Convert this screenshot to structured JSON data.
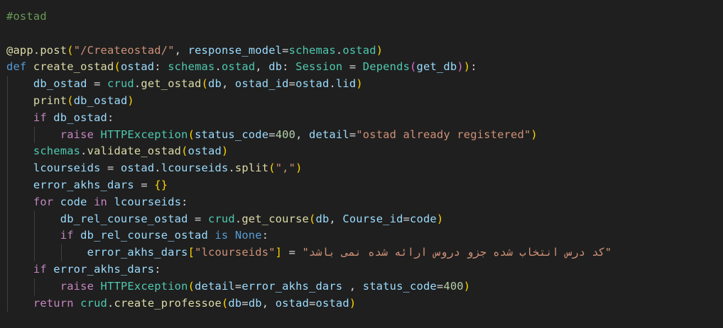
{
  "editor": {
    "comment": "#ostad",
    "decorator": {
      "at": "@",
      "obj": "app",
      "method": "post",
      "route": "\"/Createostad/\"",
      "param": "response_model",
      "schemas": "schemas",
      "model": "ostad"
    },
    "def_line": {
      "kw": "def",
      "name": "create_ostad",
      "p1": "ostad",
      "t1mod": "schemas",
      "t1cls": "ostad",
      "p2": "db",
      "t2": "Session",
      "fn": "Depends",
      "arg": "get_db"
    },
    "l3": {
      "var": "db_ostad",
      "mod": "crud",
      "fn": "get_ostad",
      "a1": "db",
      "kw": "ostad_id",
      "obj": "ostad",
      "attr": "lid"
    },
    "l4": {
      "fn": "print",
      "arg": "db_ostad"
    },
    "l5": {
      "kw": "if",
      "var": "db_ostad"
    },
    "l6": {
      "kw": "raise",
      "cls": "HTTPException",
      "k1": "status_code",
      "n1": "400",
      "k2": "detail",
      "s": "\"ostad already registered\""
    },
    "l7": {
      "mod": "schemas",
      "fn": "validate_ostad",
      "arg": "ostad"
    },
    "l8": {
      "var": "lcourseids",
      "obj": "ostad",
      "attr": "lcourseids",
      "fn": "split",
      "s": "\",\""
    },
    "l9": {
      "var": "error_akhs_dars",
      "val": "{}"
    },
    "l10": {
      "kw1": "for",
      "v": "code",
      "kw2": "in",
      "it": "lcourseids"
    },
    "l11": {
      "var": "db_rel_course_ostad",
      "mod": "crud",
      "fn": "get_course",
      "a1": "db",
      "kw": "Course_id",
      "a2": "code"
    },
    "l12": {
      "kw": "if",
      "var": "db_rel_course_ostad",
      "is": "is",
      "none": "None"
    },
    "l13": {
      "var": "error_akhs_dars",
      "key": "\"lcourseids\"",
      "persian": "\"کد درس انتخاب شده جزو دروس ارائه شده نمی باشد\""
    },
    "l14": {
      "kw": "if",
      "var": "error_akhs_dars"
    },
    "l15": {
      "kw": "raise",
      "cls": "HTTPException",
      "k1": "detail",
      "v1": "error_akhs_dars",
      "k2": "status_code",
      "n2": "400"
    },
    "l16": {
      "kw": "return",
      "mod": "crud",
      "fn": "create_professoe",
      "k1": "db",
      "v1": "db",
      "k2": "ostad",
      "v2": "ostad"
    }
  }
}
